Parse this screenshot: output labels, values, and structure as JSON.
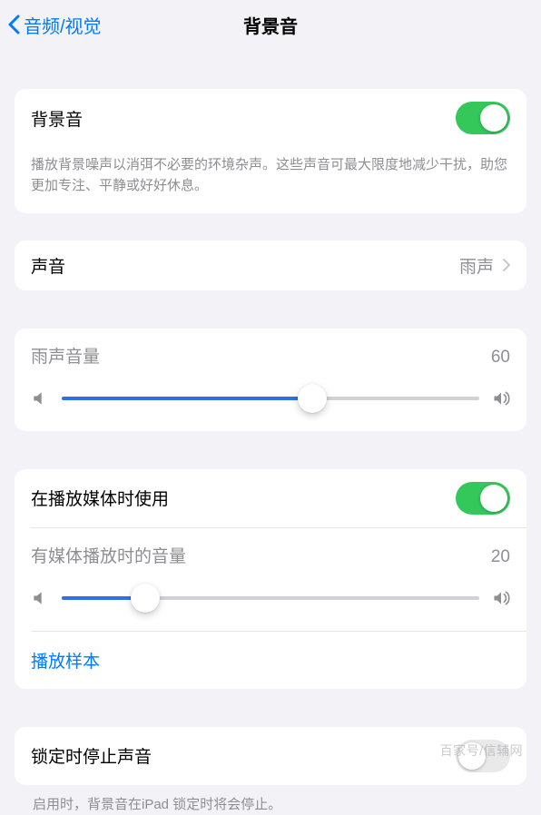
{
  "nav": {
    "back_label": "音频/视觉",
    "title": "背景音"
  },
  "group_main": {
    "toggle_label": "背景音",
    "toggle_on": true,
    "description": "播放背景噪声以消弭不必要的环境杂声。这些声音可最大限度地减少干扰，助您更加专注、平静或好好休息。"
  },
  "group_sound": {
    "label": "声音",
    "value": "雨声"
  },
  "group_volume": {
    "label": "雨声音量",
    "value": "60",
    "percent": 60
  },
  "group_media": {
    "toggle_label": "在播放媒体时使用",
    "toggle_on": true,
    "volume_label": "有媒体播放时的音量",
    "volume_value": "20",
    "volume_percent": 20,
    "sample_label": "播放样本"
  },
  "group_lock": {
    "toggle_label": "锁定时停止声音",
    "toggle_on": false,
    "description": "启用时，背景音在iPad 锁定时将会停止。"
  },
  "watermark": "百家号/信辅网"
}
